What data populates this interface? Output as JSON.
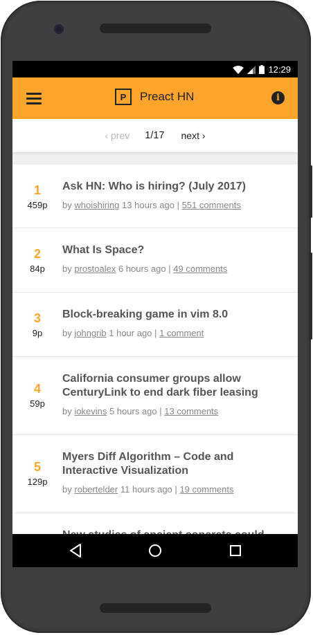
{
  "status": {
    "time": "12:29"
  },
  "app": {
    "logo_letter": "P",
    "title": "Preact HN"
  },
  "pager": {
    "prev": "‹ prev",
    "count": "1/17",
    "next": "next ›"
  },
  "stories": [
    {
      "rank": "1",
      "points": "459p",
      "title": "Ask HN: Who is hiring? (July 2017)",
      "by": "by",
      "user": "whoishiring",
      "age": "13 hours ago",
      "sep": "|",
      "comments": "551 comments"
    },
    {
      "rank": "2",
      "points": "84p",
      "title": "What Is Space?",
      "by": "by",
      "user": "prostoalex",
      "age": "6 hours ago",
      "sep": "|",
      "comments": "49 comments"
    },
    {
      "rank": "3",
      "points": "9p",
      "title": "Block-breaking game in vim 8.0",
      "by": "by",
      "user": "johngrib",
      "age": "1 hour ago",
      "sep": "|",
      "comments": "1 comment"
    },
    {
      "rank": "4",
      "points": "59p",
      "title": "California consumer groups allow CenturyLink to end dark fiber leasing",
      "by": "by",
      "user": "iokevins",
      "age": "5 hours ago",
      "sep": "|",
      "comments": "13 comments"
    },
    {
      "rank": "5",
      "points": "129p",
      "title": "Myers Diff Algorithm – Code and Interactive Visualization",
      "by": "by",
      "user": "robertelder",
      "age": "11 hours ago",
      "sep": "|",
      "comments": "19 comments"
    },
    {
      "title": "New studies of ancient concrete could"
    }
  ],
  "icons": {
    "menu": "menu-icon",
    "info": "info-icon",
    "wifi": "wifi-icon",
    "signal": "signal-icon",
    "battery": "battery-icon",
    "back": "back-icon",
    "home": "home-icon",
    "recents": "recents-icon"
  },
  "colors": {
    "accent": "#ffa42a",
    "statusbar": "#000000",
    "title_text": "#555555",
    "meta_text": "#888888"
  }
}
